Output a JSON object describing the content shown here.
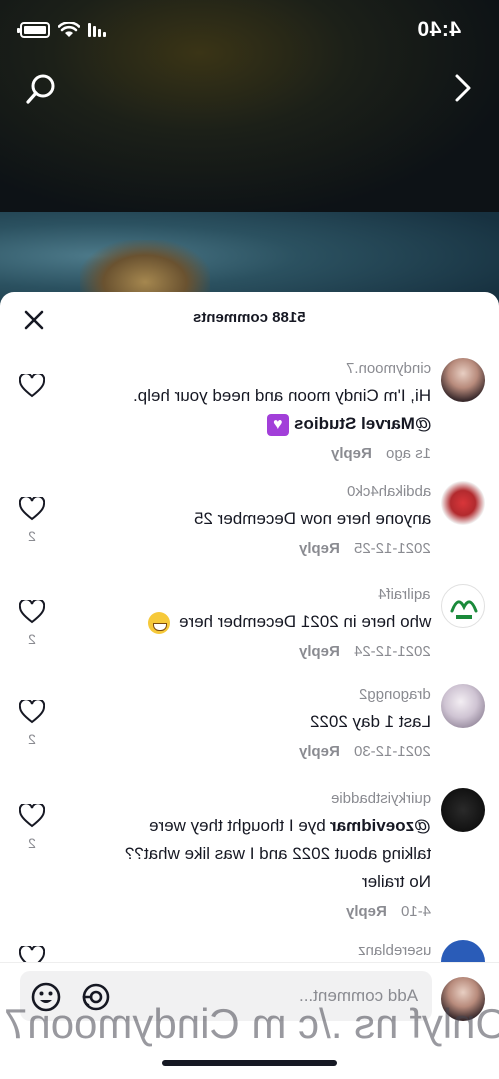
{
  "status": {
    "time": "4:40"
  },
  "colors": {
    "accent_purple": "#a23fd9",
    "text": "#161823",
    "muted": "#8a8b91"
  },
  "sheet": {
    "count_label": "5188 comments"
  },
  "comments": [
    {
      "user": "cindymoon.7",
      "text_line1": "Hi, I'm Cindy moon and need your help.",
      "mention": "@Marvel Studios",
      "time": "1s ago",
      "reply": "Reply",
      "likes": ""
    },
    {
      "user": "abdikah4ck0",
      "text_line1": "anyone here now December 25",
      "time": "2021-12-25",
      "reply": "Reply",
      "likes": "2"
    },
    {
      "user": "aqilraif4",
      "text_line1": "who here in 2021 December here",
      "time": "2021-12-24",
      "reply": "Reply",
      "likes": "2"
    },
    {
      "user": "dragongg2",
      "text_line1": "Last 1 day 2022",
      "time": "2021-12-30",
      "reply": "Reply",
      "likes": "2"
    },
    {
      "user": "quirkyistbaddie",
      "mention": "@zoevidmar",
      "text_line1": "bye I thought they were",
      "text_line2": "talking about 2022 and I was like what??",
      "text_line3": "No trailer",
      "time": "4-10",
      "reply": "Reply",
      "likes": "2"
    },
    {
      "user": "usereblanz"
    }
  ],
  "input": {
    "placeholder": "Add comment..."
  },
  "watermark": "Onlyf ns ./c m Cindymoon7",
  "icons": {
    "search": "search-icon",
    "forward": "chevron-right-icon",
    "close": "close-icon",
    "heart": "heart-outline-icon",
    "at": "at-icon",
    "emoji": "emoji-icon"
  }
}
